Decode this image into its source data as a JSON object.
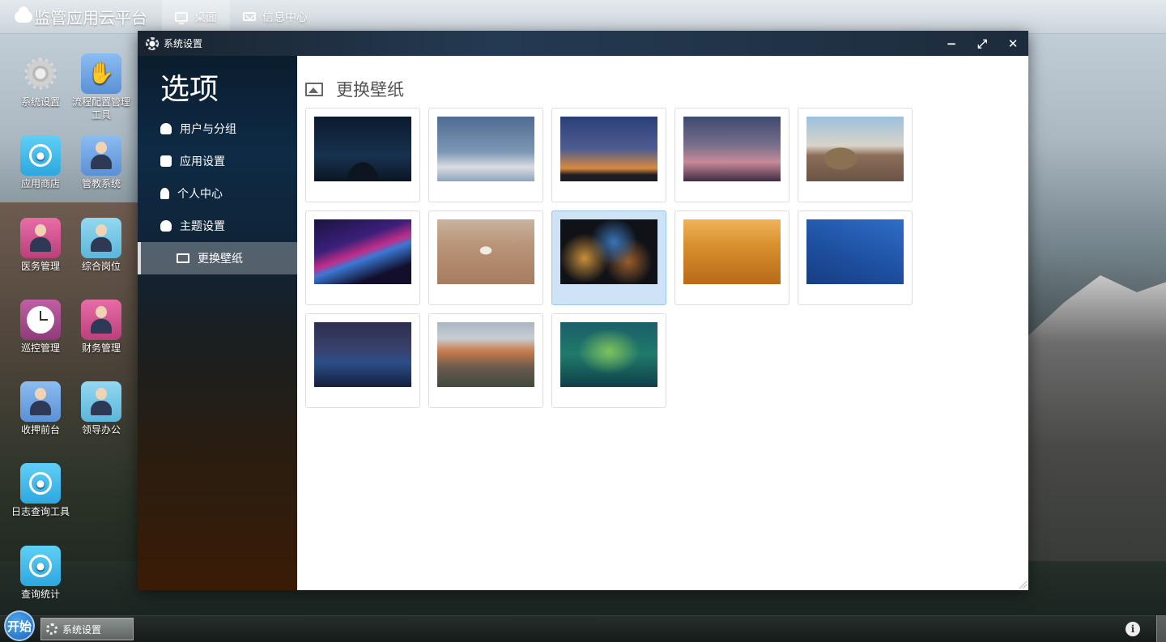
{
  "topbar": {
    "brand": "监管应用云平台",
    "nav": [
      {
        "label": "桌面",
        "icon": "desktop-icon"
      },
      {
        "label": "信息中心",
        "icon": "envelope-icon"
      }
    ]
  },
  "desktop_icons": [
    {
      "label": "系统设置",
      "icon": "gear-icon"
    },
    {
      "label": "流程配置管理工具",
      "icon": "bible-hand-icon"
    },
    {
      "label": "应用商店",
      "icon": "apple-icon"
    },
    {
      "label": "管教系统",
      "icon": "officer-icon"
    },
    {
      "label": "医务管理",
      "icon": "nurse-icon"
    },
    {
      "label": "综合岗位",
      "icon": "staff-icon"
    },
    {
      "label": "巡控管理",
      "icon": "clock-icon"
    },
    {
      "label": "财务管理",
      "icon": "nurse-icon"
    },
    {
      "label": "收押前台",
      "icon": "officer-icon"
    },
    {
      "label": "领导办公",
      "icon": "staff-icon"
    },
    {
      "label": "日志查询工具",
      "icon": "apple-icon"
    },
    {
      "label": "查询统计",
      "icon": "apple-icon"
    }
  ],
  "window": {
    "title": "系统设置",
    "controls": {
      "minimize": "−",
      "maximize": "⤢",
      "close": "✕"
    },
    "sidebar": {
      "heading": "选项",
      "items": [
        {
          "label": "用户与分组",
          "icon": "users-icon"
        },
        {
          "label": "应用设置",
          "icon": "phone-icon"
        },
        {
          "label": "个人中心",
          "icon": "user-icon"
        },
        {
          "label": "主题设置",
          "icon": "palette-icon"
        },
        {
          "label": "更换壁纸",
          "icon": "picture-icon",
          "active": true
        }
      ]
    },
    "content": {
      "title": "更换壁纸",
      "wallpapers": [
        {
          "name": "starry-night",
          "selected": false
        },
        {
          "name": "snowy-clouds",
          "selected": false
        },
        {
          "name": "sunset-tree",
          "selected": false
        },
        {
          "name": "dusk-field",
          "selected": false
        },
        {
          "name": "hay-bale",
          "selected": false
        },
        {
          "name": "purple-light-waves",
          "selected": false
        },
        {
          "name": "shell-on-beach",
          "selected": false
        },
        {
          "name": "blurred-bokeh",
          "selected": true
        },
        {
          "name": "sand-dunes",
          "selected": false
        },
        {
          "name": "blue-sky-roof",
          "selected": false
        },
        {
          "name": "blue-mountains",
          "selected": false
        },
        {
          "name": "el-capitan",
          "selected": false
        },
        {
          "name": "green-blur",
          "selected": false
        }
      ]
    }
  },
  "taskbar": {
    "start_label": "开始",
    "tasks": [
      {
        "label": "系统设置",
        "icon": "gear-icon"
      }
    ],
    "info_label": "i"
  }
}
